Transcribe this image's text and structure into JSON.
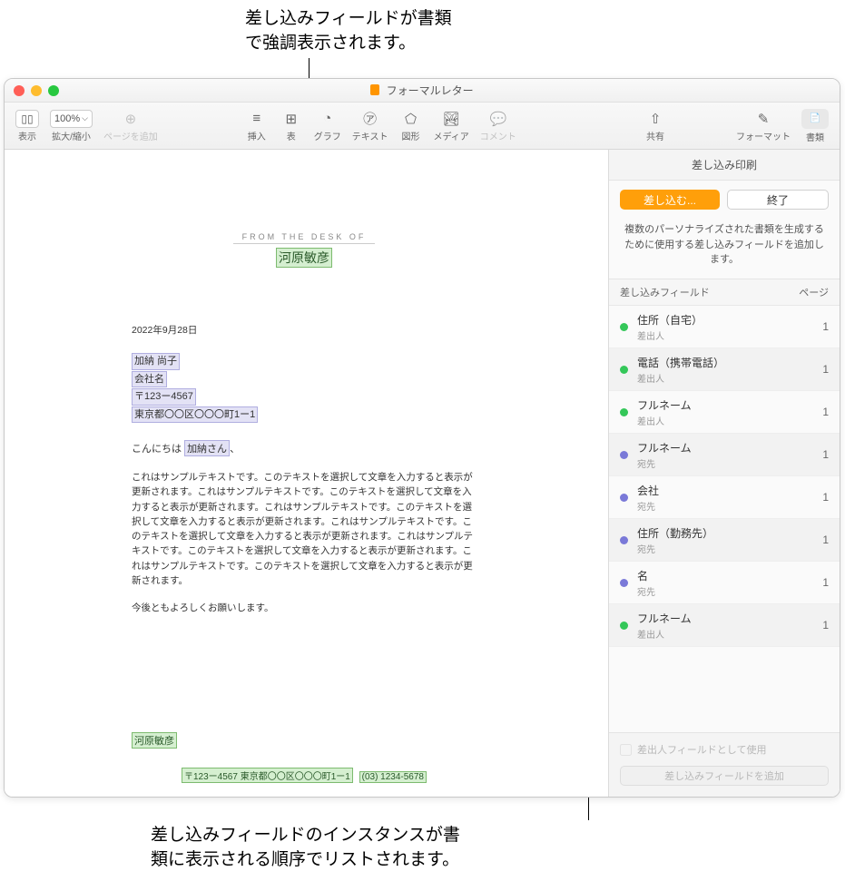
{
  "callouts": {
    "top": "差し込みフィールドが書類\nで強調表示されます。",
    "bottom": "差し込みフィールドのインスタンスが書\n類に表示される順序でリストされます。"
  },
  "window": {
    "title": "フォーマルレター"
  },
  "toolbar": {
    "view": "表示",
    "zoom_label": "拡大/縮小",
    "zoom_value": "100%",
    "add_page": "ページを追加",
    "insert": "挿入",
    "table": "表",
    "chart": "グラフ",
    "text": "テキスト",
    "shape": "図形",
    "media": "メディア",
    "comment": "コメント",
    "share": "共有",
    "format": "フォーマット",
    "document": "書類"
  },
  "doc": {
    "letterhead_prefix": "FROM THE DESK OF",
    "letterhead_name": "河原敏彦",
    "date": "2022年9月28日",
    "recipient": {
      "name": "加納 尚子",
      "company": "会社名",
      "postal": "〒123ー4567",
      "address": "東京都〇〇区〇〇〇町1ー1"
    },
    "greeting_prefix": "こんにちは",
    "greeting_name": "加納さん",
    "greeting_suffix": "、",
    "body": "これはサンプルテキストです。このテキストを選択して文章を入力すると表示が更新されます。これはサンプルテキストです。このテキストを選択して文章を入力すると表示が更新されます。これはサンプルテキストです。このテキストを選択して文章を入力すると表示が更新されます。これはサンプルテキストです。このテキストを選択して文章を入力すると表示が更新されます。これはサンプルテキストです。このテキストを選択して文章を入力すると表示が更新されます。これはサンプルテキストです。このテキストを選択して文章を入力すると表示が更新されます。",
    "closing": "今後ともよろしくお願いします。",
    "signature": "河原敏彦",
    "footer_addr": "〒123ー4567 東京都〇〇区〇〇〇町1ー1",
    "footer_phone": "(03) 1234-5678"
  },
  "sidebar": {
    "header": "差し込み印刷",
    "merge_btn": "差し込む...",
    "done_btn": "終了",
    "description": "複数のパーソナライズされた書類を生成するために使用する差し込みフィールドを追加します。",
    "col_field": "差し込みフィールド",
    "col_page": "ページ",
    "fields": [
      {
        "title": "住所（自宅）",
        "sub": "差出人",
        "color": "green",
        "page": "1"
      },
      {
        "title": "電話（携帯電話）",
        "sub": "差出人",
        "color": "green",
        "page": "1"
      },
      {
        "title": "フルネーム",
        "sub": "差出人",
        "color": "green",
        "page": "1"
      },
      {
        "title": "フルネーム",
        "sub": "宛先",
        "color": "purple",
        "page": "1"
      },
      {
        "title": "会社",
        "sub": "宛先",
        "color": "purple",
        "page": "1"
      },
      {
        "title": "住所（勤務先）",
        "sub": "宛先",
        "color": "purple",
        "page": "1"
      },
      {
        "title": "名",
        "sub": "宛先",
        "color": "purple",
        "page": "1"
      },
      {
        "title": "フルネーム",
        "sub": "差出人",
        "color": "green",
        "page": "1"
      }
    ],
    "use_as_sender": "差出人フィールドとして使用",
    "add_field": "差し込みフィールドを追加"
  }
}
